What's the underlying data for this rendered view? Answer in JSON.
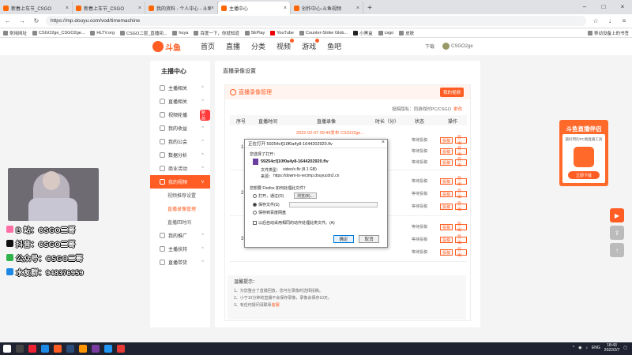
{
  "browser": {
    "tabs": [
      {
        "label": "新春上车节_CSGO",
        "active": false
      },
      {
        "label": "新春上车节_CSGO",
        "active": false
      },
      {
        "label": "我的资料 - 个人中心 - 斗鱼",
        "active": false
      },
      {
        "label": "主播中心",
        "active": true
      },
      {
        "label": "创作中心-斗鱼视频",
        "active": false
      }
    ],
    "url": "https://mp.douyu.com/vod/timemachine",
    "bookmarks": [
      "常用网址",
      "CSGO2ge_CSGO2ge...",
      "HLTV.org",
      "CSGO二层_直播间...",
      "huya",
      "百度一下，你就知道",
      "5EPlay",
      "YouTube",
      "Counter-Strike Glob...",
      "小黑盒",
      "csgo",
      "皮肤"
    ],
    "bookmark_right": "移动设备上的书签"
  },
  "site": {
    "nav": [
      "首页",
      "直播",
      "分类",
      "视频",
      "游戏",
      "鱼吧"
    ],
    "download": "下载",
    "username": "CSGO2ge"
  },
  "sidebar": {
    "title": "主播中心",
    "items": [
      {
        "label": "主播相关"
      },
      {
        "label": "直播相关"
      },
      {
        "label": "视频轮播",
        "badge": "新品"
      },
      {
        "label": "我的收益"
      },
      {
        "label": "我的公会"
      },
      {
        "label": "数据分析"
      },
      {
        "label": "商业活动"
      },
      {
        "label": "我的视频"
      }
    ],
    "subitems": [
      "视频推荐设置",
      "直播录像管理",
      "直播回时间"
    ],
    "items2": [
      {
        "label": "我的推广"
      },
      {
        "label": "主播扶持"
      },
      {
        "label": "直播带货"
      }
    ]
  },
  "content": {
    "title": "直播录像设置",
    "card_title": "直播录像管理",
    "card_button": "我的视频",
    "privacy_line": "投稿隐私：同游戏时PC/CSGO",
    "privacy_link": "更改",
    "columns": [
      "序号",
      "直播时间",
      "直播录像",
      "时长（分）",
      "状态",
      "操作"
    ],
    "rows": [
      {
        "num": "1",
        "link": "2022-02-07 09:49发布 CSGO2ge...",
        "statuses": [
          "等待投稿",
          "等待投稿",
          "等待投稿"
        ],
        "actions": [
          "投稿",
          "导出"
        ]
      },
      {
        "num": "2",
        "statuses": [
          "等待投稿",
          "等待投稿",
          "等待投稿"
        ],
        "actions": [
          "投稿",
          "导出"
        ]
      },
      {
        "num": "3",
        "statuses": [
          "等待投稿",
          "等待投稿",
          "等待投稿"
        ],
        "actions": [
          "投稿",
          "导出"
        ]
      }
    ],
    "tips_title": "温馨提示：",
    "tips": [
      "1、为您整合了直播回放，您可在录像时选择投稿。",
      "2、小于10分钟的直播不会保存录像，录像会保存10天。",
      "3、有任何疑问请联系"
    ],
    "tips_link": "客服"
  },
  "dialog": {
    "title": "正在打开 59254cf]10f0a4y8-1644202920.flv",
    "opened_label": "您选择了打开：",
    "filename": "59254cf]10f0a4y8-1644202920.flv",
    "type_label": "文件类型：",
    "type_value": "video/x-flv (8.1 GB)",
    "source_label": "来源：",
    "source_value": "https://dowm-tx-rectmp.douyucdn2.cn",
    "question": "您想要 Firefox 如何处理此文件？",
    "open_with": "打开，通过(O)",
    "browse": "浏览(B)...",
    "save_file": "保存文件(S)",
    "save_cloud": "保存到百度网盘",
    "auto_checkbox": "以后自动采用相同的动作处理此类文件。(A)",
    "ok": "确定",
    "cancel": "取消"
  },
  "promo": {
    "title": "斗鱼直播伴侣",
    "subtitle": "最好用的PC端直播工具",
    "button": "立即下载"
  },
  "overlay": [
    {
      "text": "B 站：CSGO二哥",
      "color": "#ff6fa5"
    },
    {
      "text": "抖音：CSGO二哥",
      "color": "#111111"
    },
    {
      "text": "公众号：CSGO二哥",
      "color": "#2fb34a"
    },
    {
      "text": "水友群：948376959",
      "color": "#1e88e5"
    }
  ],
  "taskbar": {
    "lang": "ENG",
    "time": "18:43",
    "date": "2022/2/7"
  },
  "colors": {
    "accent": "#ff5d23",
    "taskbar": "#1f2230"
  }
}
